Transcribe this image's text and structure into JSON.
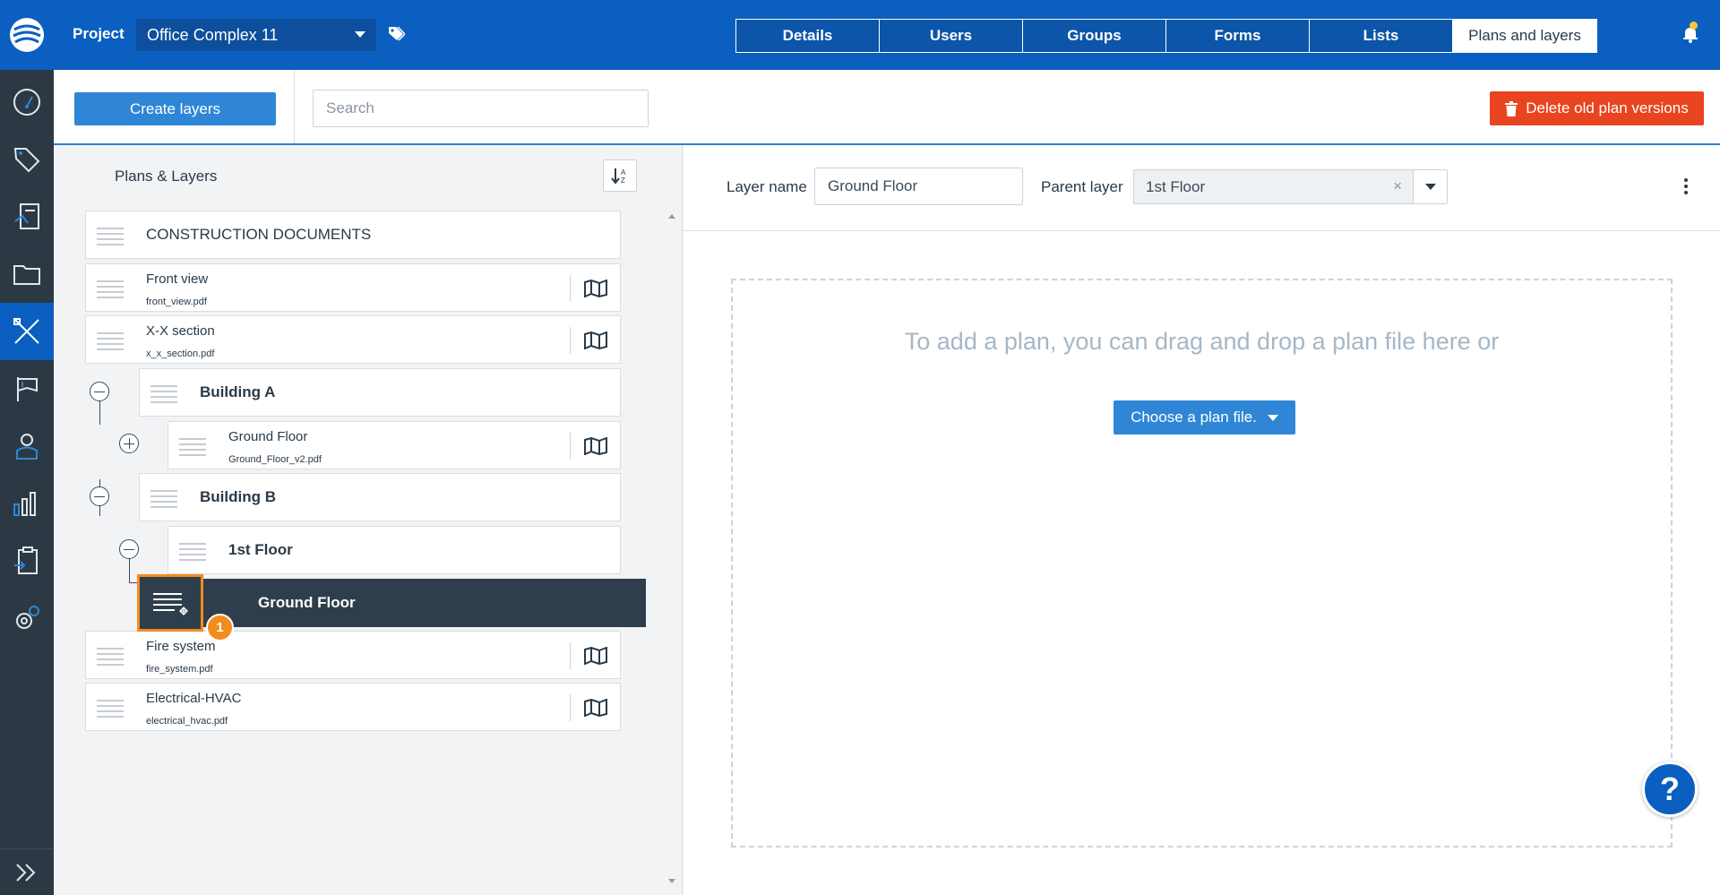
{
  "topbar": {
    "project_label": "Project",
    "project_value": "Office Complex 11",
    "tabs": [
      {
        "label": "Details"
      },
      {
        "label": "Users"
      },
      {
        "label": "Groups"
      },
      {
        "label": "Forms"
      },
      {
        "label": "Lists"
      },
      {
        "label": "Plans and layers"
      }
    ],
    "active_tab": "Plans and layers"
  },
  "toolbar": {
    "create_label": "Create layers",
    "search_placeholder": "Search",
    "delete_label": "Delete old plan versions"
  },
  "tree": {
    "title": "Plans & Layers",
    "items": [
      {
        "title": "CONSTRUCTION DOCUMENTS",
        "file": ""
      },
      {
        "title": "Front view",
        "file": "front_view.pdf"
      },
      {
        "title": "X-X section",
        "file": "x_x_section.pdf"
      },
      {
        "title": "Building A",
        "file": ""
      },
      {
        "title": "Ground Floor",
        "file": "Ground_Floor_v2.pdf"
      },
      {
        "title": "Building B",
        "file": ""
      },
      {
        "title": "1st Floor",
        "file": ""
      },
      {
        "title": "Ground Floor",
        "file": ""
      },
      {
        "title": "Fire system",
        "file": "fire_system.pdf"
      },
      {
        "title": "Electrical-HVAC",
        "file": "electrical_hvac.pdf"
      }
    ],
    "selected_index": 7,
    "drag_badge": "1"
  },
  "detail": {
    "layer_name_label": "Layer name",
    "layer_name_value": "Ground Floor",
    "parent_layer_label": "Parent layer",
    "parent_layer_value": "1st Floor",
    "clear_glyph": "×",
    "dropzone_text": "To add a plan, you can drag and drop a plan file here or",
    "choose_label": "Choose a plan file."
  },
  "help": {
    "label": "?"
  },
  "colors": {
    "brand": "#0a5fc0",
    "rail": "#2c3944",
    "danger": "#e8441f",
    "accent_orange": "#f28c1e",
    "selected_row": "#2e3e4c"
  },
  "icons": {
    "rail": [
      "logo-icon",
      "dashboard-gauge-icon",
      "tags-icon",
      "tasks-icon",
      "folder-icon",
      "plans-tools-icon",
      "flag-icon",
      "user-icon",
      "reports-chart-icon",
      "clipboard-icon",
      "settings-gear-icon",
      "expand-chevrons-icon"
    ]
  }
}
